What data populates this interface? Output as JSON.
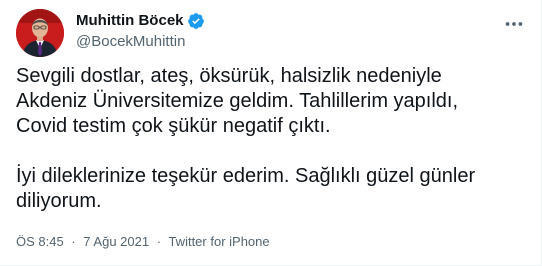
{
  "author": {
    "name": "Muhittin Böcek",
    "handle": "@BocekMuhittin",
    "verified": true
  },
  "tweet": {
    "paragraph1": "Sevgili dostlar, ateş, öksürük, halsizlik nedeniyle\nAkdeniz Üniversitemize geldim. Tahlillerim yapıldı,\nCovid testim çok şükür negatif çıktı.",
    "paragraph2": "İyi dileklerinize teşekür ederim. Sağlıklı güzel günler\ndiliyorum."
  },
  "meta": {
    "time": "ÖS 8:45",
    "separator": "·",
    "date": "7 Ağu 2021",
    "source": "Twitter for iPhone"
  },
  "icons": {
    "verified": "verified-badge-icon",
    "more": "more-options-icon"
  },
  "colors": {
    "verified_badge": "#1d9bf0",
    "text_primary": "#0f1419",
    "text_secondary": "#536471",
    "avatar_background": "#c91c1c"
  }
}
